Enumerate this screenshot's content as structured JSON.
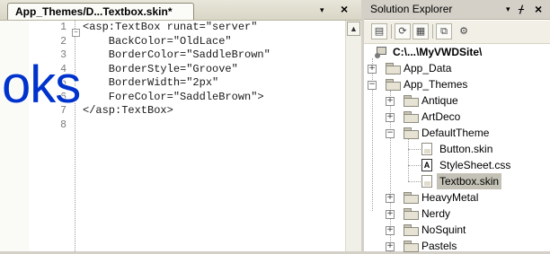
{
  "editor": {
    "tab_title": "App_Themes/D...Textbox.skin*",
    "dropdown_glyph": "▾",
    "close_glyph": "×",
    "line_numbers": [
      "1",
      "2",
      "3",
      "4",
      "5",
      "6",
      "7",
      "8"
    ],
    "code_lines": [
      "<asp:TextBox runat=\"server\"",
      "    BackColor=\"OldLace\"",
      "    BorderColor=\"SaddleBrown\"",
      "    BorderStyle=\"Groove\"",
      "    BorderWidth=\"2px\"",
      "    ForeColor=\"SaddleBrown\">",
      "</asp:TextBox>",
      ""
    ],
    "overlay_text": "oks"
  },
  "solution_explorer": {
    "title": "Solution Explorer",
    "pin_glyph": "ᚋ",
    "close_glyph": "×",
    "dropdown_glyph": "▾",
    "toolbar_icons": [
      "properties-icon",
      "refresh-icon",
      "show-all-files-icon",
      "copy-web-icon",
      "asp-config-icon"
    ],
    "tree": {
      "root": "C:\\...\\MyVWDSite\\",
      "app_data": "App_Data",
      "app_themes": "App_Themes",
      "themes": [
        "Antique",
        "ArtDeco",
        "DefaultTheme",
        "HeavyMetal",
        "Nerdy",
        "NoSquint",
        "Pastels"
      ],
      "default_theme_files": [
        "Button.skin",
        "StyleSheet.css",
        "Textbox.skin"
      ],
      "selected_file": "Textbox.skin"
    }
  }
}
